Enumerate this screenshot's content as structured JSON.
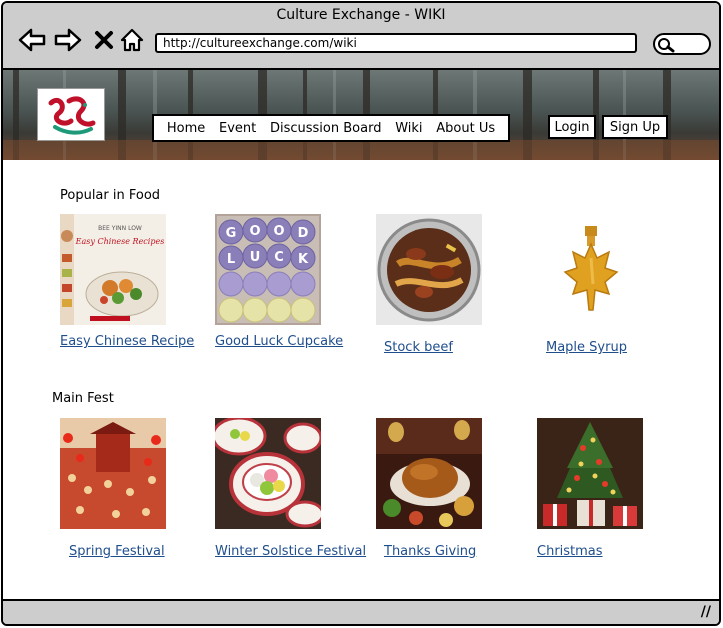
{
  "window": {
    "title": "Culture Exchange - WIKI",
    "url": "http://cultureexchange.com/wiki"
  },
  "menu": {
    "items": [
      "Home",
      "Event",
      "Discussion Board",
      "Wiki",
      "About Us"
    ]
  },
  "auth": {
    "login": "Login",
    "signup": "Sign Up"
  },
  "sections": [
    {
      "title": "Popular in Food",
      "items": [
        {
          "label": "Easy Chinese Recipe",
          "image": "cookbook-cover"
        },
        {
          "label": "Good Luck Cupcake",
          "image": "cupcakes"
        },
        {
          "label": "Stock beef",
          "image": "beef-pot"
        },
        {
          "label": "Maple Syrup",
          "image": "maple-syrup-bottle"
        }
      ]
    },
    {
      "title": "Main Fest",
      "items": [
        {
          "label": "Spring Festival",
          "image": "spring-festival"
        },
        {
          "label": "Winter Solstice Festival",
          "image": "tangyuan-bowls"
        },
        {
          "label": "Thanks Giving",
          "image": "roast-turkey"
        },
        {
          "label": "Christmas",
          "image": "christmas-tree"
        }
      ]
    }
  ],
  "cookbook": {
    "author": "BEE YINN LOW",
    "title": "Easy Chinese Recipes"
  },
  "cupcake_letters": [
    "G",
    "O",
    "O",
    "D",
    "L",
    "U",
    "C",
    "K"
  ],
  "colors": {
    "link": "#1f4e8c",
    "chrome": "#cdcdcd"
  }
}
